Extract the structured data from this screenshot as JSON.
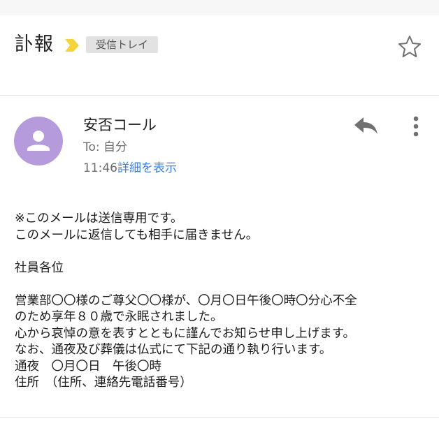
{
  "subject": {
    "title": "訃報",
    "label": "受信トレイ",
    "importance_icon": "importance-marker-icon",
    "star_icon": "star-outline-icon"
  },
  "message": {
    "sender": "安否コール",
    "recipient": "To: 自分",
    "time": "11:46",
    "details_link": "詳細を表示",
    "avatar_icon": "person-icon",
    "reply_icon": "reply-icon",
    "more_icon": "more-vertical-icon"
  },
  "body_lines": [
    "※このメールは送信専用です。",
    "このメールに返信しても相手に届きません。",
    "",
    "社員各位",
    "",
    "営業部〇〇様のご尊父〇〇様が、〇月〇日午後〇時〇分心不全",
    "のため享年８０歳で永眠されました。",
    "心から哀悼の意を表すとともに謹んでお知らせ申し上げます。",
    "なお、通夜及び葬儀は仏式にて下記の通り執り行います。",
    "通夜　〇月〇日　午後〇時",
    "住所　（住所、連絡先電話番号）"
  ],
  "colors": {
    "avatar_bg": "#b59bdb",
    "importance_yellow": "#f3d43a",
    "link_blue": "#3b82e0",
    "icon_gray": "#707070"
  }
}
